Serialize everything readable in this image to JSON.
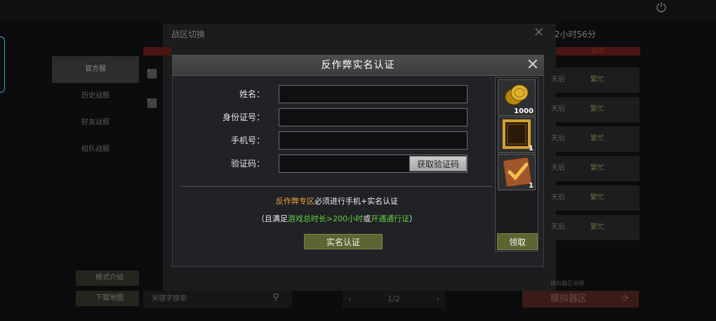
{
  "background": {
    "server_panel_title": "战区切换",
    "timer": "2小时56分",
    "status_header": "状态",
    "side_menu": [
      "官方服",
      "历史战服",
      "好友战服",
      "组队战服"
    ],
    "status_rows": [
      {
        "label": "天后",
        "state": "繁忙"
      },
      {
        "label": "天后",
        "state": "繁忙"
      },
      {
        "label": "天后",
        "state": "繁忙"
      },
      {
        "label": "天后",
        "state": "繁忙"
      },
      {
        "label": "天后",
        "state": "繁忙"
      },
      {
        "label": "天后",
        "state": "繁忙"
      }
    ],
    "mode_intro": "模式介绍",
    "download_map": "下载地图",
    "search_placeholder": "关键字搜索",
    "pager": "1/2",
    "emulator_btn": "模拟器区",
    "emulator_note": "模拟器区说明"
  },
  "dialog": {
    "title": "反作弊实名认证",
    "fields": {
      "name_label": "姓名：",
      "id_label": "身份证号：",
      "phone_label": "手机号：",
      "code_label": "验证码：",
      "name_value": "",
      "id_value": "",
      "phone_value": "",
      "code_value": ""
    },
    "get_code_button": "获取验证码",
    "notice_line1": {
      "highlight": "反作弊专区",
      "rest": "必须进行手机+实名认证"
    },
    "notice_line2": {
      "open": "（且满足",
      "highlight1": "游戏总时长>200小时",
      "mid": "或",
      "highlight2": "开通通行证",
      "close": "）"
    },
    "verify_button": "实名认证",
    "rewards": [
      {
        "icon": "gold-coins-icon",
        "count": "1000"
      },
      {
        "icon": "gold-frame-icon",
        "count": "1"
      },
      {
        "icon": "check-badge-icon",
        "count": "1"
      }
    ],
    "claim_button": "领取"
  },
  "colors": {
    "highlight_orange": "#f0a33a",
    "highlight_green": "#5fd13f",
    "button_olive": "#5c6532"
  }
}
